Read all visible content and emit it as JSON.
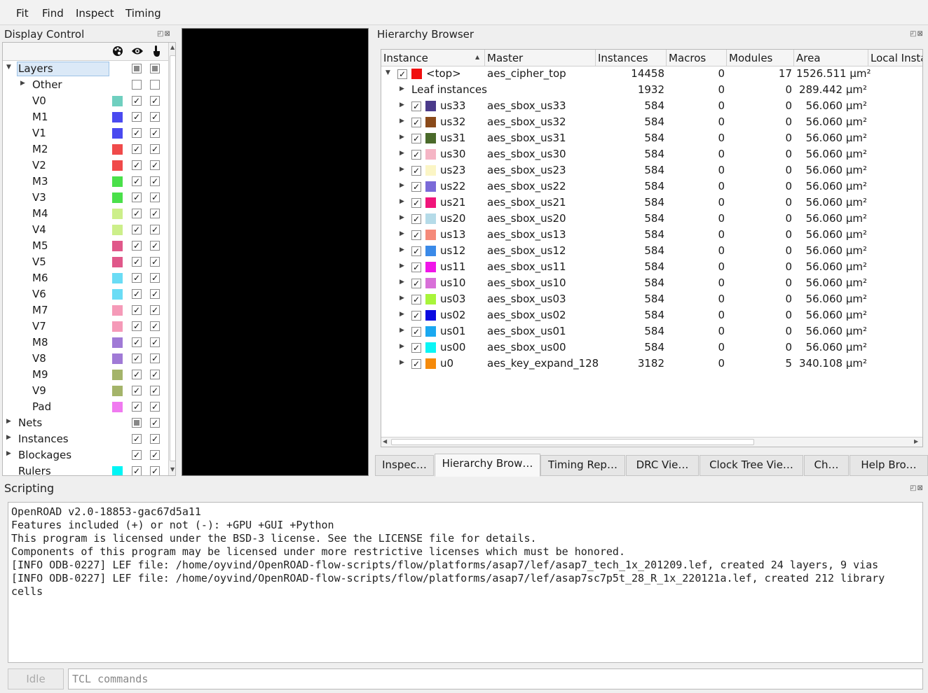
{
  "menu": [
    "Fit",
    "Find",
    "Inspect",
    "Timing"
  ],
  "display_control": {
    "title": "Display Control",
    "layers_label": "Layers",
    "rows": [
      {
        "label": "Other",
        "indent": 2,
        "arrow": "right",
        "color": null,
        "visible": "empty",
        "selectable": "empty"
      },
      {
        "label": "V0",
        "indent": 2,
        "color": "#6fcfbf",
        "visible": "checked",
        "selectable": "checked"
      },
      {
        "label": "M1",
        "indent": 2,
        "color": "#4a4af0",
        "visible": "checked",
        "selectable": "checked"
      },
      {
        "label": "V1",
        "indent": 2,
        "color": "#4a4af0",
        "visible": "checked",
        "selectable": "checked"
      },
      {
        "label": "M2",
        "indent": 2,
        "color": "#f04a4a",
        "visible": "checked",
        "selectable": "checked"
      },
      {
        "label": "V2",
        "indent": 2,
        "color": "#f04a4a",
        "visible": "checked",
        "selectable": "checked"
      },
      {
        "label": "M3",
        "indent": 2,
        "color": "#4ae04a",
        "visible": "checked",
        "selectable": "checked"
      },
      {
        "label": "V3",
        "indent": 2,
        "color": "#4ae04a",
        "visible": "checked",
        "selectable": "checked"
      },
      {
        "label": "M4",
        "indent": 2,
        "color": "#ccef8a",
        "visible": "checked",
        "selectable": "checked"
      },
      {
        "label": "V4",
        "indent": 2,
        "color": "#ccef8a",
        "visible": "checked",
        "selectable": "checked"
      },
      {
        "label": "M5",
        "indent": 2,
        "color": "#e0588a",
        "visible": "checked",
        "selectable": "checked"
      },
      {
        "label": "V5",
        "indent": 2,
        "color": "#e0588a",
        "visible": "checked",
        "selectable": "checked"
      },
      {
        "label": "M6",
        "indent": 2,
        "color": "#6adcf5",
        "visible": "checked",
        "selectable": "checked"
      },
      {
        "label": "V6",
        "indent": 2,
        "color": "#6adcf5",
        "visible": "checked",
        "selectable": "checked"
      },
      {
        "label": "M7",
        "indent": 2,
        "color": "#f59ab8",
        "visible": "checked",
        "selectable": "checked"
      },
      {
        "label": "V7",
        "indent": 2,
        "color": "#f59ab8",
        "visible": "checked",
        "selectable": "checked"
      },
      {
        "label": "M8",
        "indent": 2,
        "color": "#a07ad6",
        "visible": "checked",
        "selectable": "checked"
      },
      {
        "label": "V8",
        "indent": 2,
        "color": "#a07ad6",
        "visible": "checked",
        "selectable": "checked"
      },
      {
        "label": "M9",
        "indent": 2,
        "color": "#a4b46a",
        "visible": "checked",
        "selectable": "checked"
      },
      {
        "label": "V9",
        "indent": 2,
        "color": "#a4b46a",
        "visible": "checked",
        "selectable": "checked"
      },
      {
        "label": "Pad",
        "indent": 2,
        "color": "#f07af0",
        "visible": "checked",
        "selectable": "checked"
      },
      {
        "label": "Nets",
        "indent": 1,
        "arrow": "right",
        "color": null,
        "visible": "partial",
        "selectable": "checked"
      },
      {
        "label": "Instances",
        "indent": 1,
        "arrow": "right",
        "color": null,
        "visible": "checked",
        "selectable": "checked"
      },
      {
        "label": "Blockages",
        "indent": 1,
        "arrow": "right",
        "color": null,
        "visible": "checked",
        "selectable": "checked"
      },
      {
        "label": "Rulers",
        "indent": 1,
        "color": "#00f5f5",
        "visible": "checked",
        "selectable": "checked"
      }
    ]
  },
  "hierarchy_browser": {
    "title": "Hierarchy Browser",
    "columns": [
      "Instance",
      "Master",
      "Instances",
      "Macros",
      "Modules",
      "Area",
      "Local Insta"
    ],
    "rows": [
      {
        "arrow": "down",
        "indent": 0,
        "checkbox": true,
        "color": "#f01010",
        "instance": "<top>",
        "master": "aes_cipher_top",
        "instances": "14458",
        "macros": "0",
        "modules": "17",
        "area": "1526.511 µm²"
      },
      {
        "arrow": "right",
        "indent": 1,
        "checkbox": false,
        "color": null,
        "instance": "Leaf instances",
        "master": "",
        "instances": "1932",
        "macros": "0",
        "modules": "0",
        "area": "289.442 µm²"
      },
      {
        "arrow": "right",
        "indent": 1,
        "checkbox": true,
        "color": "#4a3a8a",
        "instance": "us33",
        "master": "aes_sbox_us33",
        "instances": "584",
        "macros": "0",
        "modules": "0",
        "area": "56.060 µm²"
      },
      {
        "arrow": "right",
        "indent": 1,
        "checkbox": true,
        "color": "#8a4a1a",
        "instance": "us32",
        "master": "aes_sbox_us32",
        "instances": "584",
        "macros": "0",
        "modules": "0",
        "area": "56.060 µm²"
      },
      {
        "arrow": "right",
        "indent": 1,
        "checkbox": true,
        "color": "#4a6a2a",
        "instance": "us31",
        "master": "aes_sbox_us31",
        "instances": "584",
        "macros": "0",
        "modules": "0",
        "area": "56.060 µm²"
      },
      {
        "arrow": "right",
        "indent": 1,
        "checkbox": true,
        "color": "#f5b5c5",
        "instance": "us30",
        "master": "aes_sbox_us30",
        "instances": "584",
        "macros": "0",
        "modules": "0",
        "area": "56.060 µm²"
      },
      {
        "arrow": "right",
        "indent": 1,
        "checkbox": true,
        "color": "#fbf5c5",
        "instance": "us23",
        "master": "aes_sbox_us23",
        "instances": "584",
        "macros": "0",
        "modules": "0",
        "area": "56.060 µm²"
      },
      {
        "arrow": "right",
        "indent": 1,
        "checkbox": true,
        "color": "#7a6ad8",
        "instance": "us22",
        "master": "aes_sbox_us22",
        "instances": "584",
        "macros": "0",
        "modules": "0",
        "area": "56.060 µm²"
      },
      {
        "arrow": "right",
        "indent": 1,
        "checkbox": true,
        "color": "#f0157a",
        "instance": "us21",
        "master": "aes_sbox_us21",
        "instances": "584",
        "macros": "0",
        "modules": "0",
        "area": "56.060 µm²"
      },
      {
        "arrow": "right",
        "indent": 1,
        "checkbox": true,
        "color": "#b5dbe8",
        "instance": "us20",
        "master": "aes_sbox_us20",
        "instances": "584",
        "macros": "0",
        "modules": "0",
        "area": "56.060 µm²"
      },
      {
        "arrow": "right",
        "indent": 1,
        "checkbox": true,
        "color": "#f58a7a",
        "instance": "us13",
        "master": "aes_sbox_us13",
        "instances": "584",
        "macros": "0",
        "modules": "0",
        "area": "56.060 µm²"
      },
      {
        "arrow": "right",
        "indent": 1,
        "checkbox": true,
        "color": "#3a8ae8",
        "instance": "us12",
        "master": "aes_sbox_us12",
        "instances": "584",
        "macros": "0",
        "modules": "0",
        "area": "56.060 µm²"
      },
      {
        "arrow": "right",
        "indent": 1,
        "checkbox": true,
        "color": "#f015e8",
        "instance": "us11",
        "master": "aes_sbox_us11",
        "instances": "584",
        "macros": "0",
        "modules": "0",
        "area": "56.060 µm²"
      },
      {
        "arrow": "right",
        "indent": 1,
        "checkbox": true,
        "color": "#d870d8",
        "instance": "us10",
        "master": "aes_sbox_us10",
        "instances": "584",
        "macros": "0",
        "modules": "0",
        "area": "56.060 µm²"
      },
      {
        "arrow": "right",
        "indent": 1,
        "checkbox": true,
        "color": "#a8f53a",
        "instance": "us03",
        "master": "aes_sbox_us03",
        "instances": "584",
        "macros": "0",
        "modules": "0",
        "area": "56.060 µm²"
      },
      {
        "arrow": "right",
        "indent": 1,
        "checkbox": true,
        "color": "#0a0ae0",
        "instance": "us02",
        "master": "aes_sbox_us02",
        "instances": "584",
        "macros": "0",
        "modules": "0",
        "area": "56.060 µm²"
      },
      {
        "arrow": "right",
        "indent": 1,
        "checkbox": true,
        "color": "#1aa8f0",
        "instance": "us01",
        "master": "aes_sbox_us01",
        "instances": "584",
        "macros": "0",
        "modules": "0",
        "area": "56.060 µm²"
      },
      {
        "arrow": "right",
        "indent": 1,
        "checkbox": true,
        "color": "#0af5f5",
        "instance": "us00",
        "master": "aes_sbox_us00",
        "instances": "584",
        "macros": "0",
        "modules": "0",
        "area": "56.060 µm²"
      },
      {
        "arrow": "right",
        "indent": 1,
        "checkbox": true,
        "color": "#f58a0a",
        "instance": "u0",
        "master": "aes_key_expand_128",
        "instances": "3182",
        "macros": "0",
        "modules": "5",
        "area": "340.108 µm²"
      }
    ]
  },
  "tabs": [
    {
      "label": "Inspec…",
      "active": false
    },
    {
      "label": "Hierarchy Brow…",
      "active": true
    },
    {
      "label": "Timing Rep…",
      "active": false
    },
    {
      "label": "DRC Vie…",
      "active": false
    },
    {
      "label": "Clock Tree Vie…",
      "active": false
    },
    {
      "label": "Ch…",
      "active": false
    },
    {
      "label": "Help Bro…",
      "active": false
    }
  ],
  "scripting": {
    "title": "Scripting",
    "output": [
      "OpenROAD v2.0-18853-gac67d5a11",
      "Features included (+) or not (-): +GPU +GUI +Python",
      "This program is licensed under the BSD-3 license. See the LICENSE file for details.",
      "Components of this program may be licensed under more restrictive licenses which must be honored.",
      "[INFO ODB-0227] LEF file: /home/oyvind/OpenROAD-flow-scripts/flow/platforms/asap7/lef/asap7_tech_1x_201209.lef, created 24 layers, 9 vias",
      "[INFO ODB-0227] LEF file: /home/oyvind/OpenROAD-flow-scripts/flow/platforms/asap7/lef/asap7sc7p5t_28_R_1x_220121a.lef, created 212 library cells"
    ],
    "status": "Idle",
    "input_placeholder": "TCL commands"
  },
  "dock_buttons": "◰⊠"
}
